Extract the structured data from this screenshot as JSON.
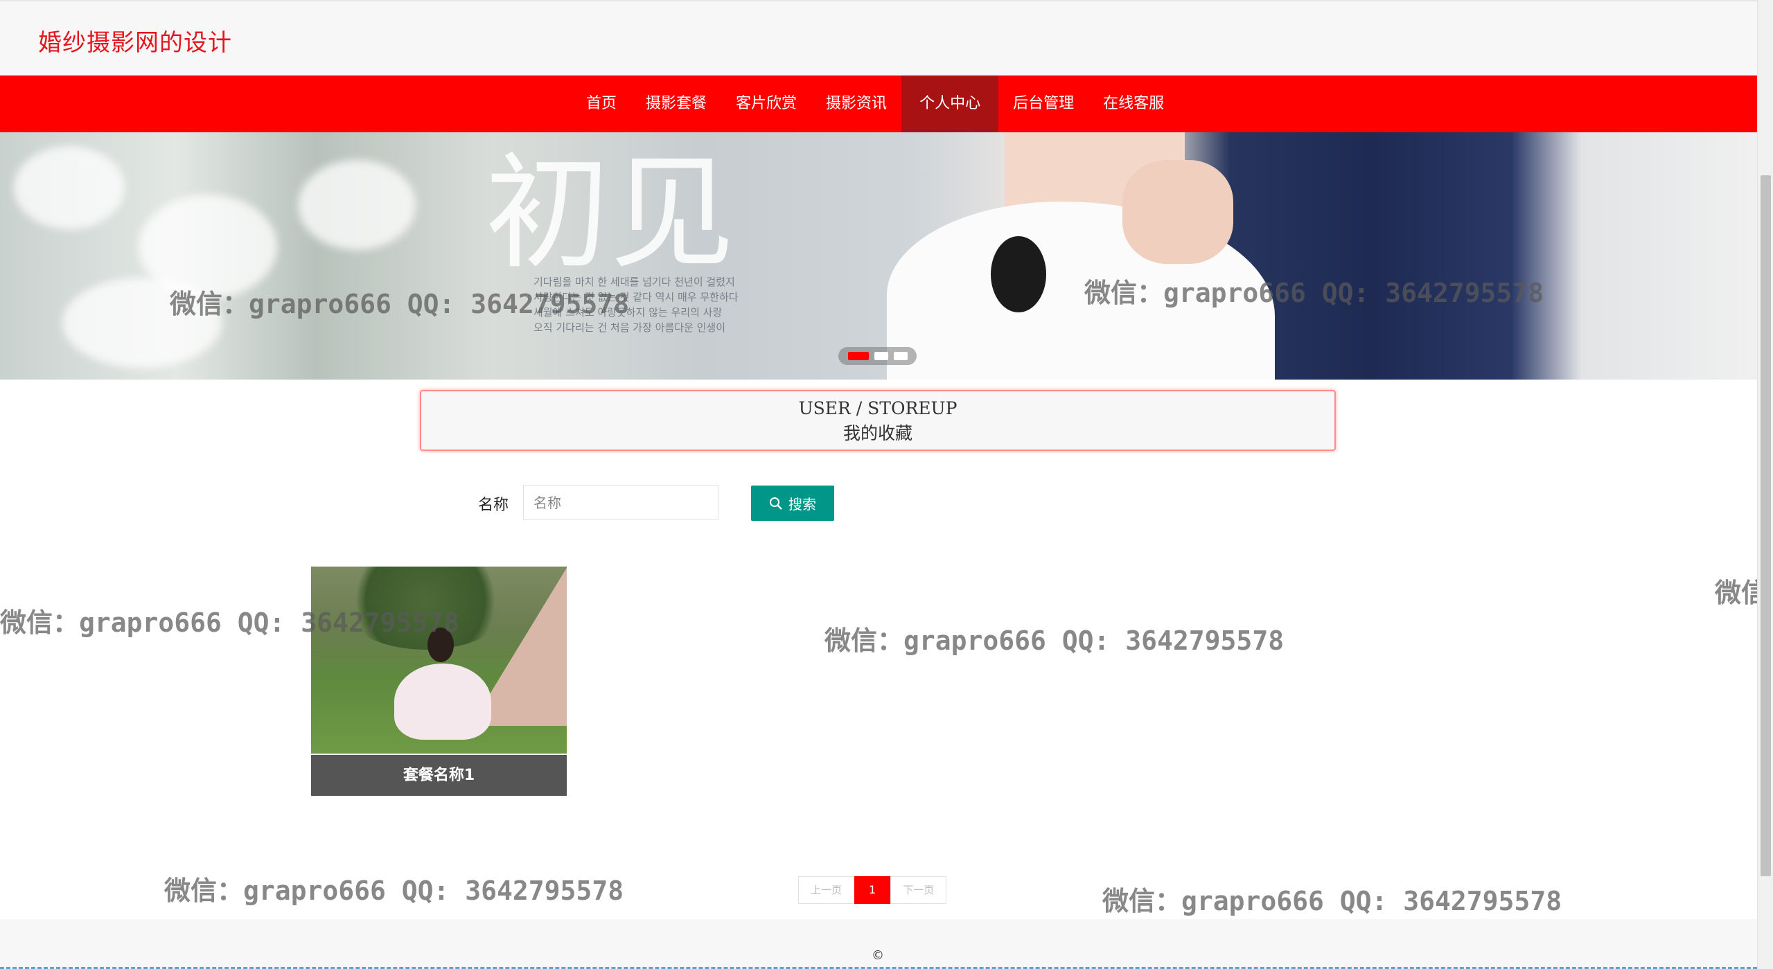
{
  "site": {
    "title": "婚纱摄影网的设计"
  },
  "nav": {
    "items": [
      "首页",
      "摄影套餐",
      "客片欣赏",
      "摄影资讯",
      "个人中心",
      "后台管理",
      "在线客服"
    ],
    "active": "个人中心"
  },
  "banner": {
    "glyph": "初见",
    "korean_text": [
      "기다림을 마치 한 세대를 넘기다 천년이 걸렸지",
      "사랑한다는 것 없는 것 같다 역시 매우 무한하다",
      "세월에 스쳐도 아랑곳하지 않는 우리의 사랑",
      "오직 기다리는 건 처음 가장 아름다운 인생이"
    ],
    "slides": 3,
    "active_slide": 1
  },
  "section": {
    "title_en": "USER / STOREUP",
    "title_cn": "我的收藏"
  },
  "search": {
    "label": "名称",
    "placeholder": "名称",
    "value": "",
    "button_label": "搜索"
  },
  "items": [
    {
      "name": "套餐名称1"
    }
  ],
  "pagination": {
    "prev": "上一页",
    "current": "1",
    "next": "下一页"
  },
  "footer": {
    "copyright": "©"
  },
  "watermark": {
    "text": "微信：grapro666 QQ: 3642795578",
    "partial_text": "微信"
  },
  "colors": {
    "primary": "#ff0000",
    "nav_active": "#a81212",
    "search_button": "#009688",
    "title": "#e4161d"
  }
}
